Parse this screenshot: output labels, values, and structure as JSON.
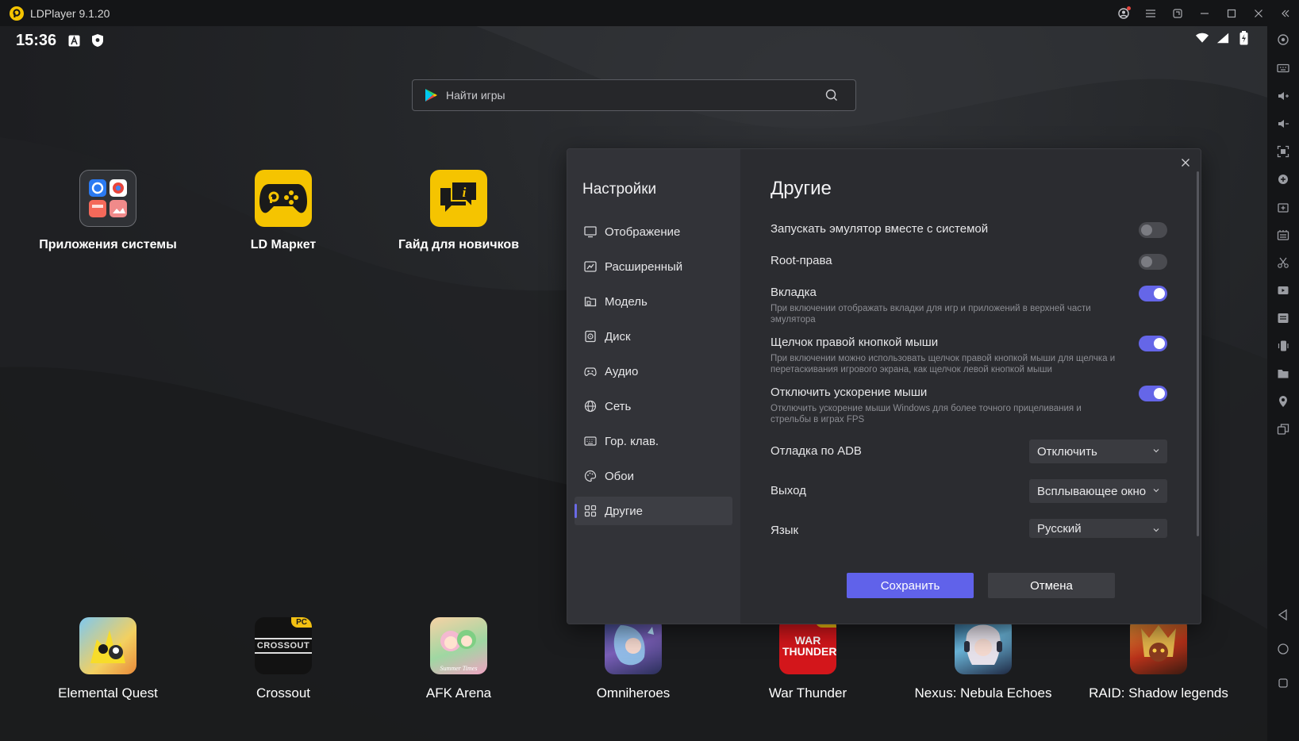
{
  "titlebar": {
    "app_name": "LDPlayer 9.1.20"
  },
  "statusbar": {
    "time": "15:36"
  },
  "search": {
    "placeholder": "Найти игры"
  },
  "desktop_top": [
    {
      "name": "apps-folder",
      "label": "Приложения системы"
    },
    {
      "name": "ld-market",
      "label": "LD Маркет"
    },
    {
      "name": "beginner-guide",
      "label": "Гайд для новичков"
    }
  ],
  "desktop_games": [
    {
      "label": "Elemental Quest",
      "badge": ""
    },
    {
      "label": "Crossout",
      "badge": "PC",
      "tile_text": "CROSSOUT"
    },
    {
      "label": "AFK Arena",
      "badge": "",
      "tile_text": "Summer Times"
    },
    {
      "label": "Omniheroes",
      "badge": ""
    },
    {
      "label": "War Thunder",
      "badge": "PC",
      "tile_text": "WAR THUNDER"
    },
    {
      "label": "Nexus: Nebula Echoes",
      "badge": ""
    },
    {
      "label": "RAID: Shadow legends",
      "badge": ""
    }
  ],
  "settings": {
    "title": "Настройки",
    "nav": [
      {
        "label": "Отображение",
        "icon": "monitor-icon"
      },
      {
        "label": "Расширенный",
        "icon": "advanced-icon"
      },
      {
        "label": "Модель",
        "icon": "folder-icon"
      },
      {
        "label": "Диск",
        "icon": "disk-icon"
      },
      {
        "label": "Аудио",
        "icon": "gamepad-icon"
      },
      {
        "label": "Сеть",
        "icon": "globe-icon"
      },
      {
        "label": "Гор. клав.",
        "icon": "keyboard-icon"
      },
      {
        "label": "Обои",
        "icon": "palette-icon"
      },
      {
        "label": "Другие",
        "icon": "grid-icon",
        "active": true
      }
    ],
    "section_title": "Другие",
    "options": [
      {
        "label": "Запускать эмулятор вместе с системой",
        "desc": "",
        "on": false
      },
      {
        "label": "Root-права",
        "desc": "",
        "on": false
      },
      {
        "label": "Вкладка",
        "desc": "При включении отображать вкладки для игр и приложений в верхней части эмулятора",
        "on": true
      },
      {
        "label": "Щелчок правой кнопкой мыши",
        "desc": "При включении можно использовать щелчок правой кнопкой мыши для щелчка и перетаскивания игрового экрана, как щелчок левой кнопкой мыши",
        "on": true
      },
      {
        "label": "Отключить ускорение мыши",
        "desc": "Отключить ускорение мыши Windows для более точного прицеливания и стрельбы в играх FPS",
        "on": true
      }
    ],
    "selects": [
      {
        "label": "Отладка по ADB",
        "value": "Отключить"
      },
      {
        "label": "Выход",
        "value": "Всплывающее окно"
      },
      {
        "label": "Язык",
        "value": "Русский"
      }
    ],
    "save_label": "Сохранить",
    "cancel_label": "Отмена"
  },
  "colors": {
    "accent": "#6062ea",
    "brand_yellow": "#f5c400"
  }
}
